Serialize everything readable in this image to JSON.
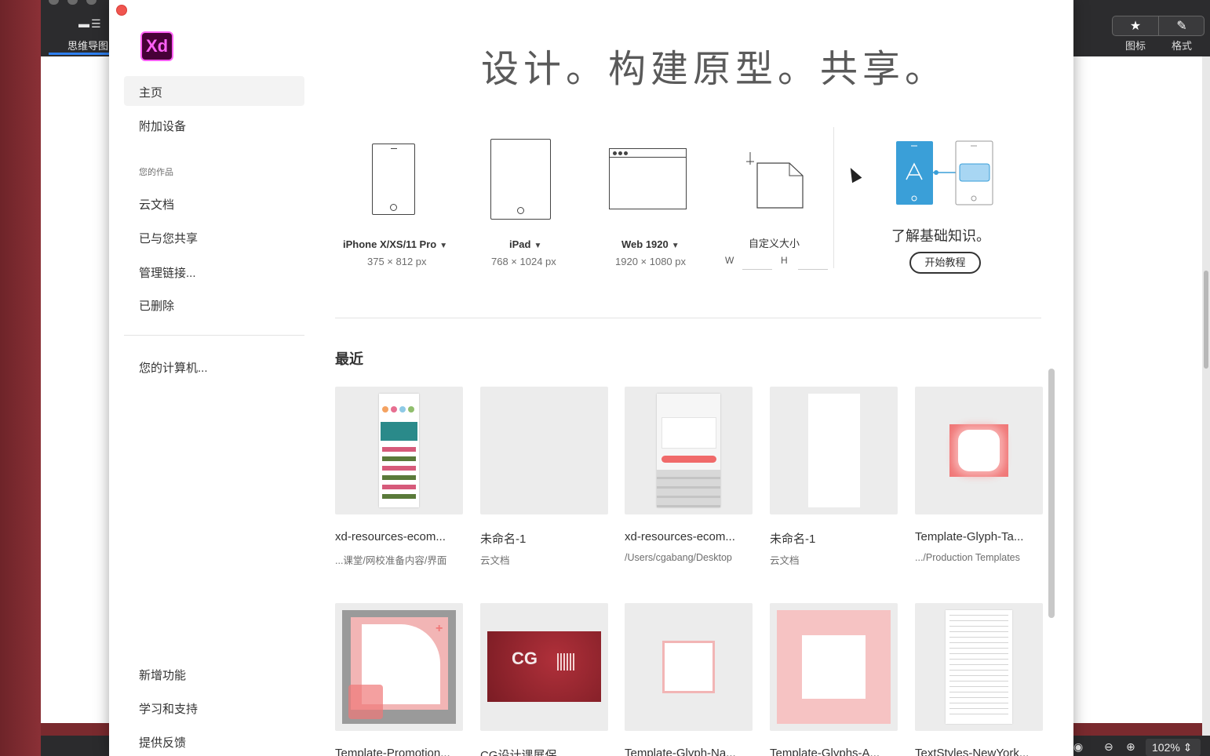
{
  "host": {
    "tab_label": "思维导图",
    "toolbar": [
      {
        "icon": "★",
        "label": "图标"
      },
      {
        "icon": "✎",
        "label": "格式"
      }
    ],
    "zoom": "102%",
    "bottom_icons": [
      "eye-icon",
      "zoom-out-icon",
      "zoom-in-icon"
    ]
  },
  "app": {
    "logo_text": "Xd",
    "hero_title": "设计。构建原型。共享。"
  },
  "nav": {
    "home": "主页",
    "add_device": "附加设备",
    "section_title": "您的作品",
    "cloud_docs": "云文档",
    "shared": "已与您共享",
    "manage_links": "管理链接...",
    "deleted": "已删除",
    "computer": "您的计算机...",
    "whats_new": "新增功能",
    "learn_support": "学习和支持",
    "feedback": "提供反馈"
  },
  "presets": [
    {
      "name": "iPhone X/XS/11 Pro",
      "size": "375 × 812 px"
    },
    {
      "name": "iPad",
      "size": "768 × 1024 px"
    },
    {
      "name": "Web 1920",
      "size": "1920 × 1080 px"
    }
  ],
  "custom": {
    "name": "自定义大小",
    "w_label": "W",
    "h_label": "H"
  },
  "learn": {
    "title": "了解基础知识。",
    "button": "开始教程"
  },
  "recent": {
    "title": "最近",
    "items": [
      {
        "title": "xd-resources-ecom...",
        "sub": "...课堂/网校准备内容/界面"
      },
      {
        "title": "未命名-1",
        "sub": "云文档"
      },
      {
        "title": "xd-resources-ecom...",
        "sub": "/Users/cgabang/Desktop"
      },
      {
        "title": "未命名-1",
        "sub": "云文档"
      },
      {
        "title": "Template-Glyph-Ta...",
        "sub": ".../Production Templates"
      },
      {
        "title": "Template-Promotion...",
        "sub": ""
      },
      {
        "title": "CG设计课展保...",
        "sub": ""
      },
      {
        "title": "Template-Glyph-Na...",
        "sub": ""
      },
      {
        "title": "Template-Glyphs-A...",
        "sub": ""
      },
      {
        "title": "TextStyles-NewYork...",
        "sub": ""
      }
    ]
  },
  "colors": {
    "xd_logo_bg": "#470137",
    "xd_logo_fg": "#ff61f6",
    "tutorial_blue": "#3a9fd8",
    "close_red": "#f0554f"
  }
}
